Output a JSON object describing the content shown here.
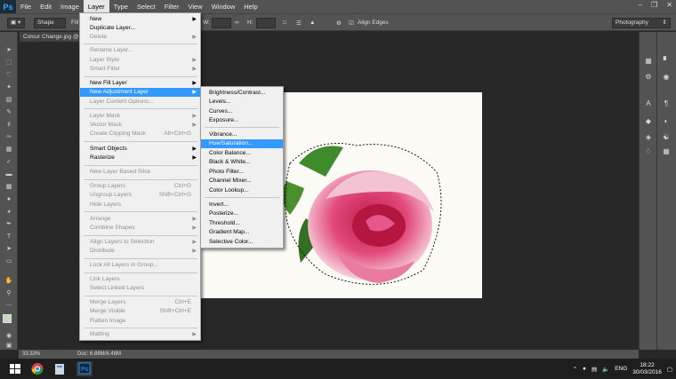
{
  "app": {
    "logo": "Ps"
  },
  "menubar": {
    "items": [
      "File",
      "Edit",
      "Image",
      "Layer",
      "Type",
      "Select",
      "Filter",
      "View",
      "Window",
      "Help"
    ],
    "active": "Layer"
  },
  "options": {
    "shape_mode": "Shape",
    "fill_label": "Fill",
    "w_label": "W:",
    "h_label": "H:",
    "align_edges": "Align Edges",
    "workspace": "Photography"
  },
  "document": {
    "tab": "Colour Change.jpg @"
  },
  "status": {
    "zoom": "33.33%",
    "doc": "Doc: 6.88M/6.48M"
  },
  "layer_menu": {
    "new": "New",
    "duplicate": "Duplicate Layer...",
    "delete": "Delete",
    "rename": "Rename Layer...",
    "layer_style": "Layer Style",
    "smart_filter": "Smart Filter",
    "new_fill": "New Fill Layer",
    "new_adjustment": "New Adjustment Layer",
    "content_options": "Layer Content Options...",
    "layer_mask": "Layer Mask",
    "vector_mask": "Vector Mask",
    "clipping_mask": "Create Clipping Mask",
    "clipping_mask_sc": "Alt+Ctrl+G",
    "smart_objects": "Smart Objects",
    "rasterize": "Rasterize",
    "new_layer_slice": "New Layer Based Slice",
    "group": "Group Layers",
    "group_sc": "Ctrl+G",
    "ungroup": "Ungroup Layers",
    "ungroup_sc": "Shift+Ctrl+G",
    "hide": "Hide Layers",
    "arrange": "Arrange",
    "combine": "Combine Shapes",
    "align": "Align Layers to Selection",
    "distribute": "Distribute",
    "lock_all": "Lock All Layers in Group...",
    "link": "Link Layers",
    "select_linked": "Select Linked Layers",
    "merge": "Merge Layers",
    "merge_sc": "Ctrl+E",
    "merge_visible": "Merge Visible",
    "merge_visible_sc": "Shift+Ctrl+E",
    "flatten": "Flatten Image",
    "matting": "Matting"
  },
  "adjustment_submenu": {
    "items": [
      "Brightness/Contrast...",
      "Levels...",
      "Curves...",
      "Exposure...",
      "Vibrance...",
      "Hue/Saturation...",
      "Color Balance...",
      "Black & White...",
      "Photo Filter...",
      "Channel Mixer...",
      "Color Lookup...",
      "Invert...",
      "Posterize...",
      "Threshold...",
      "Gradient Map...",
      "Selective Color..."
    ],
    "highlighted": "Hue/Saturation..."
  },
  "taskbar": {
    "lang": "ENG",
    "time": "18:22",
    "date": "30/03/2016"
  },
  "colors": {
    "highlight": "#3399ff",
    "ui": "#535353",
    "rose": "#d8356a"
  }
}
